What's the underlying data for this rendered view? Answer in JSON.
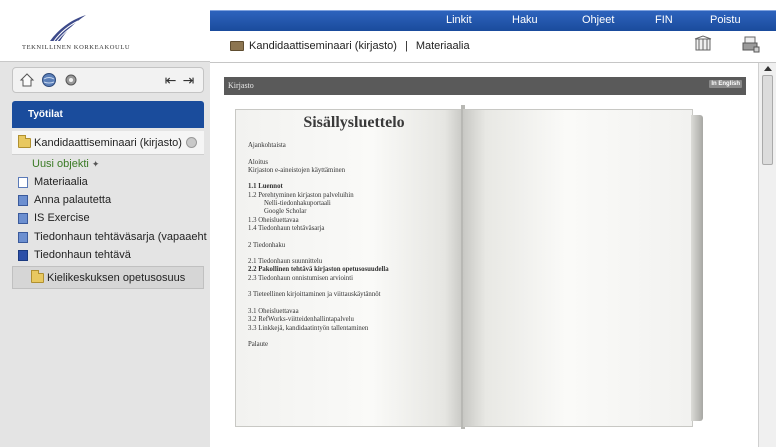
{
  "logo": {
    "text": "TEKNILLINEN KORKEAKOULU",
    "icon": "university-logo"
  },
  "topbar": {
    "links": [
      "Linkit",
      "Haku",
      "Ohjeet",
      "FIN",
      "Poistu"
    ]
  },
  "breadcrumb": {
    "course": "Kandidaattiseminaari (kirjasto)",
    "separator": "|",
    "page": "Materiaalia"
  },
  "toolbar": {
    "icons": [
      "home-icon",
      "globe-icon",
      "settings-icon"
    ],
    "back_icon": "arrow-left-icon",
    "forward_icon": "arrow-right-icon"
  },
  "sidebar": {
    "workspaces_label": "Työtilat",
    "course_title": "Kandidaattiseminaari (kirjasto)",
    "new_object_label": "Uusi objekti",
    "items": [
      {
        "label": "Materiaalia",
        "icon": "document-icon"
      },
      {
        "label": "Anna palautetta",
        "icon": "form-icon"
      },
      {
        "label": "IS Exercise",
        "icon": "exercise-icon"
      },
      {
        "label": "Tiedonhaun tehtäväsarja (vapaaeht",
        "icon": "exercise-icon"
      },
      {
        "label": "Tiedonhaun tehtävä",
        "icon": "task-icon"
      }
    ],
    "language_center_label": "Kielikeskuksen opetusosuus"
  },
  "content": {
    "header_label": "Kirjasto",
    "english_badge": "In English",
    "toc": {
      "title": "Sisällysluettelo",
      "lines": [
        {
          "text": "Ajankohtaista",
          "style": "normal"
        },
        {
          "text": "",
          "style": "blank"
        },
        {
          "text": "Aloitus",
          "style": "normal"
        },
        {
          "text": "Kirjaston e-aineistojen käyttäminen",
          "style": "normal"
        },
        {
          "text": "",
          "style": "blank"
        },
        {
          "text": "1.1 Luennot",
          "style": "bold"
        },
        {
          "text": "1.2 Perehtyminen kirjaston palveluihin",
          "style": "normal"
        },
        {
          "text": "Nelli-tiedonhakuportaali",
          "style": "indent"
        },
        {
          "text": "Google Scholar",
          "style": "indent"
        },
        {
          "text": "1.3 Oheisluettavaa",
          "style": "normal"
        },
        {
          "text": "1.4 Tiedonhaun tehtäväsarja",
          "style": "normal"
        },
        {
          "text": "",
          "style": "blank"
        },
        {
          "text": "2 Tiedonhaku",
          "style": "normal"
        },
        {
          "text": "",
          "style": "blank"
        },
        {
          "text": "2.1 Tiedonhaun suunnittelu",
          "style": "normal"
        },
        {
          "text": "2.2 Pakollinen tehtävä kirjaston opetusosuudella",
          "style": "bold"
        },
        {
          "text": "2.3 Tiedonhaun onnistumisen arviointi",
          "style": "normal"
        },
        {
          "text": "",
          "style": "blank"
        },
        {
          "text": "3 Tieteellinen kirjoittaminen ja viittauskäytännöt",
          "style": "normal"
        },
        {
          "text": "",
          "style": "blank"
        },
        {
          "text": "3.1 Oheisluettavaa",
          "style": "normal"
        },
        {
          "text": "3.2 RefWorks-viitteidenhallintapalvelu",
          "style": "normal"
        },
        {
          "text": "3.3 Linkkejä, kandidaatintyön tallentaminen",
          "style": "normal"
        },
        {
          "text": "",
          "style": "blank"
        },
        {
          "text": "Palaute",
          "style": "normal"
        }
      ]
    }
  },
  "colors": {
    "brand_blue": "#1a4b9c",
    "sidebar_bg": "#e4e4e4",
    "new_object_green": "#3a7a24"
  }
}
